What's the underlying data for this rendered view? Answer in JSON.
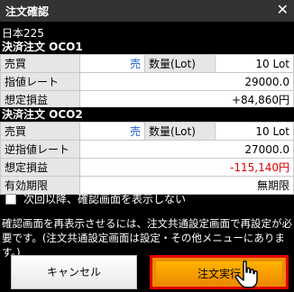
{
  "dialog": {
    "title": "注文確認",
    "close_glyph": "✕"
  },
  "product": "日本225",
  "oco1": {
    "header": "決済注文 OCO1",
    "rows": [
      {
        "label": "売買",
        "value": "売",
        "label2": "数量(Lot)",
        "value2": "10 Lot"
      },
      {
        "label": "指値レート",
        "value": "29000.0"
      },
      {
        "label": "想定損益",
        "value": "+84,860円"
      }
    ]
  },
  "oco2": {
    "header": "決済注文 OCO2",
    "rows": [
      {
        "label": "売買",
        "value": "売",
        "label2": "数量(Lot)",
        "value2": "10 Lot"
      },
      {
        "label": "逆指値レート",
        "value": "27000.0"
      },
      {
        "label": "想定損益",
        "value": "-115,140円"
      },
      {
        "label": "有効期限",
        "value": "無期限"
      }
    ]
  },
  "confirm_checkbox": {
    "label": "次回以降、確認画面を表示しない",
    "checked": false
  },
  "note": "確認画面を再表示させるには、注文共通設定画面で再設定が必要です。(注文共通設定画面は設定・その他メニューにあります。)",
  "buttons": {
    "cancel": "キャンセル",
    "execute": "注文実行"
  },
  "colors": {
    "sell_blue": "#1a5bd6",
    "loss_red": "#e00000",
    "execute_orange": "#f08c00",
    "highlight_border": "#e00000"
  },
  "icons": {
    "cursor": "hand-pointer-icon",
    "close": "close-icon"
  }
}
